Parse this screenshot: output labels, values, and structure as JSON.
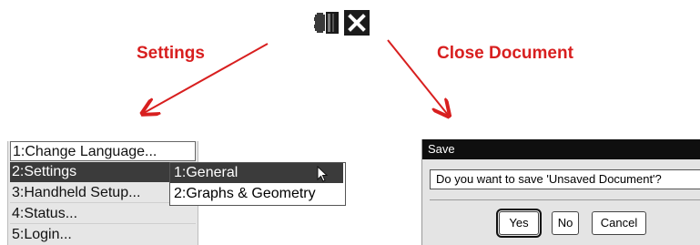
{
  "icons": {
    "settings": "settings-icon",
    "close": "close-document-icon"
  },
  "callouts": {
    "settings": "Settings",
    "close": "Close Document"
  },
  "colors": {
    "callout_red": "#d81f1f",
    "selection": "#3b3b3b",
    "titlebar": "#0f0f0f"
  },
  "menu": {
    "items": [
      {
        "label": "1:Change Language..."
      },
      {
        "label": "2:Settings"
      },
      {
        "label": "3:Handheld Setup..."
      },
      {
        "label": "4:Status..."
      },
      {
        "label": "5:Login..."
      }
    ],
    "submenu": [
      {
        "label": "1:General"
      },
      {
        "label": "2:Graphs & Geometry"
      }
    ]
  },
  "dialog": {
    "title": "Save",
    "question": "Do you want to save 'Unsaved Document'?",
    "buttons": {
      "yes": "Yes",
      "no": "No",
      "cancel": "Cancel"
    }
  }
}
